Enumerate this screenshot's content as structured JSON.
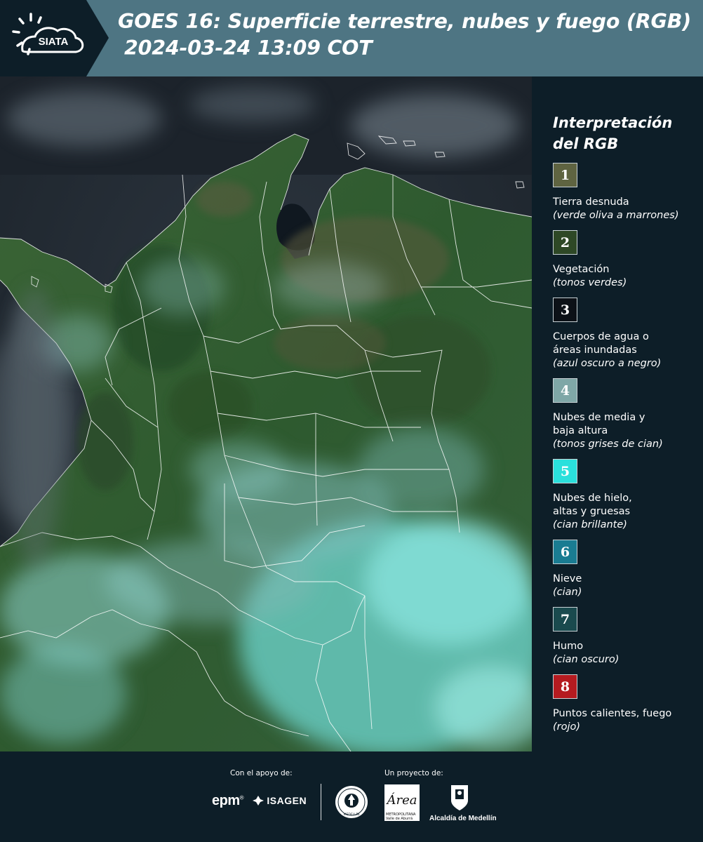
{
  "header": {
    "logo_text": "SIATA",
    "title_line1": "GOES 16: Superficie terrestre, nubes y fuego (RGB)",
    "title_line2": "2024-03-24 13:09 COT"
  },
  "legend": {
    "title_line1": "Interpretación",
    "title_line2": "del RGB",
    "items": [
      {
        "num": "1",
        "color": "#5f6441",
        "label1": "Tierra desnuda",
        "label2": "",
        "sub": "(verde oliva a marrones)"
      },
      {
        "num": "2",
        "color": "#2e4826",
        "label1": "Vegetación",
        "label2": "",
        "sub": "(tonos verdes)"
      },
      {
        "num": "3",
        "color": "#0c1117",
        "label1": "Cuerpos de agua o",
        "label2": "áreas inundadas",
        "sub": "(azul oscuro a negro)"
      },
      {
        "num": "4",
        "color": "#7fa7a7",
        "label1": "Nubes de media y",
        "label2": "baja altura",
        "sub": "(tonos grises de cian)"
      },
      {
        "num": "5",
        "color": "#2ae0dc",
        "label1": "Nubes de hielo,",
        "label2": "altas y gruesas",
        "sub": "(cian brillante)"
      },
      {
        "num": "6",
        "color": "#1a7c92",
        "label1": "Nieve",
        "label2": "",
        "sub": "(cian)"
      },
      {
        "num": "7",
        "color": "#1a4a4e",
        "label1": "Humo",
        "label2": "",
        "sub": "(cian oscuro)"
      },
      {
        "num": "8",
        "color": "#b51b20",
        "label1": "Puntos calientes, fuego",
        "label2": "",
        "sub": "(rojo)"
      }
    ]
  },
  "footer": {
    "support_label": "Con el apoyo de:",
    "project_label": "Un proyecto de:",
    "epm": "epm",
    "isagen": "ISAGEN",
    "area_line1": "Área",
    "area_line2": "METROPOLITANA",
    "area_line3": "Valle de Aburrá",
    "seal_text": "MEDELLÍN",
    "medellin": "Alcaldía de Medellín"
  }
}
